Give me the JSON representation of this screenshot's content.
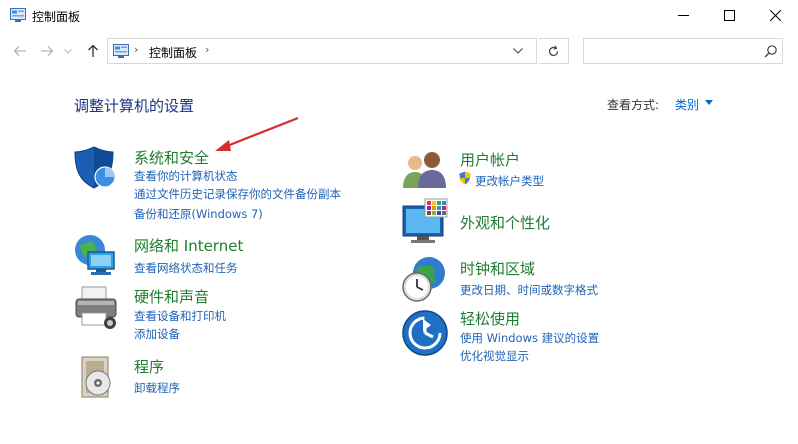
{
  "window": {
    "title": "控制面板",
    "minimize_label": "—",
    "maximize_label": "☐",
    "close_label": "✕"
  },
  "nav": {
    "breadcrumb": "控制面板",
    "search_placeholder": ""
  },
  "main": {
    "heading": "调整计算机的设置",
    "view_by_label": "查看方式:",
    "view_by_value": "类别"
  },
  "categories": [
    {
      "title": "系统和安全",
      "icon": "shield-icon",
      "links": [
        "查看你的计算机状态",
        "通过文件历史记录保存你的文件备份副本",
        "备份和还原(Windows 7)"
      ]
    },
    {
      "title": "网络和 Internet",
      "icon": "network-globe-icon",
      "links": [
        "查看网络状态和任务"
      ]
    },
    {
      "title": "硬件和声音",
      "icon": "printer-icon",
      "links": [
        "查看设备和打印机",
        "添加设备"
      ]
    },
    {
      "title": "程序",
      "icon": "programs-icon",
      "links": [
        "卸载程序"
      ]
    },
    {
      "title": "用户帐户",
      "icon": "users-icon",
      "links": [
        "更改帐户类型"
      ]
    },
    {
      "title": "外观和个性化",
      "icon": "display-palette-icon",
      "links": []
    },
    {
      "title": "时钟和区域",
      "icon": "clock-globe-icon",
      "links": [
        "更改日期、时间或数字格式"
      ]
    },
    {
      "title": "轻松使用",
      "icon": "ease-of-access-icon",
      "links": [
        "使用 Windows 建议的设置",
        "优化视觉显示"
      ]
    }
  ],
  "colors": {
    "category_title": "#1f7d2f",
    "link": "#1f63b8",
    "heading": "#1e3287",
    "annotation_arrow": "#d32f2f"
  }
}
